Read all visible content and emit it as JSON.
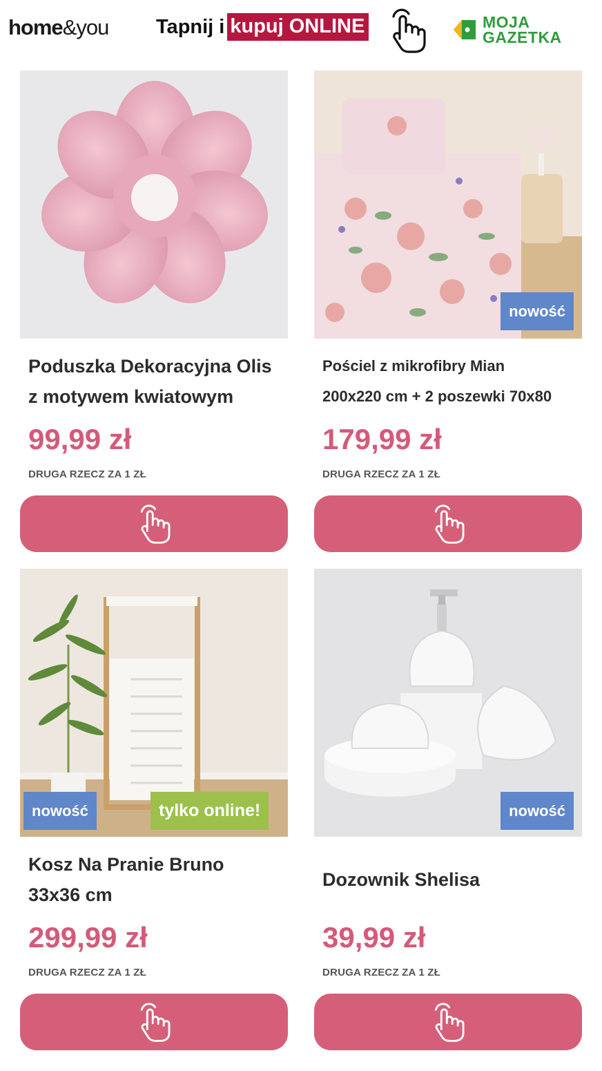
{
  "header": {
    "brand_bold": "home",
    "brand_light": "&you",
    "promo_prefix": "Tapnij i",
    "promo_highlight": "kupuj ONLINE",
    "gazetka_line1": "MOJA",
    "gazetka_line2": "GAZETKA",
    "tap_icon": "hand-pointer-icon",
    "gazetka_icon": "price-tag-icon"
  },
  "colors": {
    "price": "#d45a7a",
    "cta": "#d55f79",
    "badge_new": "#5f87c9",
    "badge_online": "#9cc04b",
    "promo_highlight": "#b5173f",
    "gazetka_green": "#2e9d3c"
  },
  "products": [
    {
      "title_line1": "Poduszka Dekoracyjna Olis",
      "title_line2": "z motywem kwiatowym",
      "price": "99,99 zł",
      "promo": "DRUGA RZECZ ZA 1 ZŁ",
      "badges": []
    },
    {
      "title_line1": "Pościel z mikrofibry Mian",
      "title_line2": "200x220 cm + 2 poszewki 70x80",
      "price": "179,99 zł",
      "promo": "DRUGA RZECZ ZA 1 ZŁ",
      "badges": [
        "nowość"
      ]
    },
    {
      "title_line1": "Kosz Na Pranie Bruno",
      "title_line2": "33x36 cm",
      "price": "299,99 zł",
      "promo": "DRUGA RZECZ ZA 1 ZŁ",
      "badges": [
        "nowość",
        "tylko online!"
      ]
    },
    {
      "title_line1": "Dozownik Shelisa",
      "title_line2": "",
      "price": "39,99 zł",
      "promo": "DRUGA RZECZ ZA 1 ZŁ",
      "badges": [
        "nowość"
      ]
    }
  ]
}
